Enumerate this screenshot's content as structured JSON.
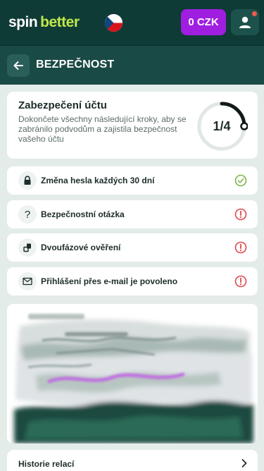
{
  "header": {
    "logo_part1": "spin",
    "logo_part2": "better",
    "balance": "0 CZK",
    "flag_icon": "czech-flag-icon",
    "user_icon": "user-icon"
  },
  "page": {
    "title": "BEZPEČNOST"
  },
  "security": {
    "title": "Zabezpečení účtu",
    "description": "Dokončete všechny následující kroky, aby se zabránilo podvodům a zajistila bezpečnost vašeho účtu",
    "progress_label": "1/4",
    "completed": 1,
    "total": 4
  },
  "steps": [
    {
      "label": "Změna hesla každých 30 dní",
      "icon": "lock-icon",
      "status": "done"
    },
    {
      "label": "Bezpečnostní otázka",
      "icon": "question-icon",
      "status": "warning"
    },
    {
      "label": "Dvoufázové ověření",
      "icon": "two-factor-icon",
      "status": "warning"
    },
    {
      "label": "Přihlášení přes e-mail je povoleno",
      "icon": "mail-icon",
      "status": "warning"
    }
  ],
  "sessions": {
    "history_label": "Historie relací"
  },
  "colors": {
    "header_bg": "#0f3b36",
    "subheader_bg": "#1a4a45",
    "accent_purple": "#a01ee0",
    "logo_green": "#bfe84a",
    "success": "#7ab648",
    "warning": "#e0474c"
  }
}
